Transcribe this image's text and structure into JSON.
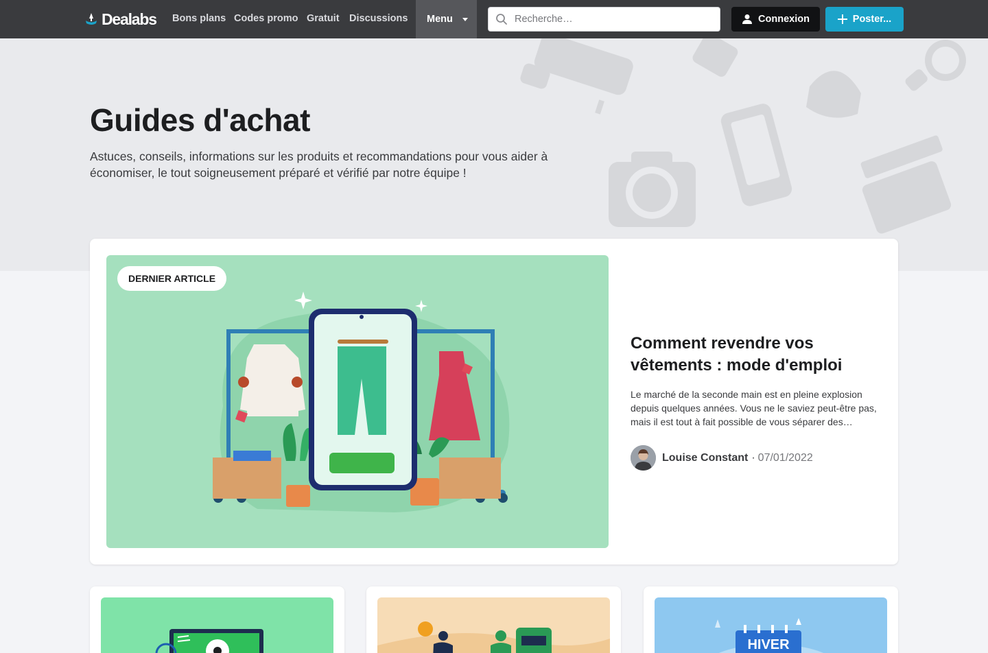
{
  "header": {
    "logo_text": "Dealabs",
    "nav": [
      "Bons plans",
      "Codes promo",
      "Gratuit",
      "Discussions"
    ],
    "menu_label": "Menu",
    "search_placeholder": "Recherche…",
    "login_label": "Connexion",
    "post_label": "Poster..."
  },
  "hero": {
    "title": "Guides d'achat",
    "description": "Astuces, conseils, informations sur les produits et recommandations pour vous aider à économiser, le tout soigneusement préparé et vérifié par notre équipe !"
  },
  "featured": {
    "badge": "DERNIER ARTICLE",
    "title": "Comment revendre vos vêtements : mode d'emploi",
    "excerpt": "Le marché de la seconde main est en pleine explosion depuis quelques années. Vous ne le saviez peut-être pas, mais il est tout à fait possible de vous séparer des…",
    "author": "Louise Constant",
    "separator": "·",
    "date": "07/01/2022"
  },
  "cards": [
    {
      "image_label": ""
    },
    {
      "image_label": ""
    },
    {
      "image_label": "HIVER"
    }
  ],
  "colors": {
    "topbar": "#3a3b3e",
    "accent": "#1aa3c9",
    "featured_bg": "#a5e0be"
  }
}
